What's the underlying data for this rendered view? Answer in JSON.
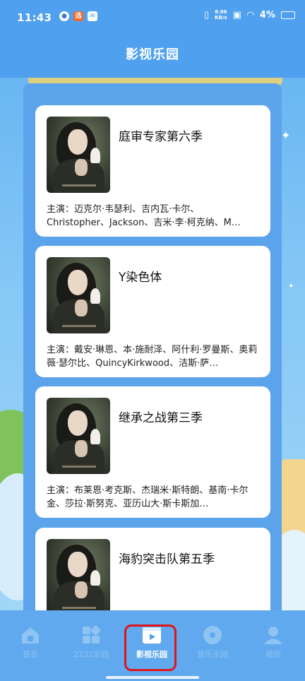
{
  "status_bar": {
    "time": "11:43",
    "net_speed": "8.90",
    "net_unit": "KB/s",
    "battery": "4%",
    "app_badge": "选"
  },
  "header": {
    "title": "影视乐园"
  },
  "movies": [
    {
      "title": "庭审专家第六季",
      "cast": "主演：迈克尔·韦瑟利、吉内瓦·卡尔、Christopher、Jackson、吉米·李·柯克纳、M…"
    },
    {
      "title": "Y染色体",
      "cast": "主演：戴安·琳恩、本·施耐泽、阿什利·罗曼斯、奥莉薇·瑟尔比、QuincyKirkwood、洁斯·萨…"
    },
    {
      "title": "继承之战第三季",
      "cast": "主演：布莱恩·考克斯、杰瑞米·斯特朗、基南·卡尔金、莎拉·斯努克、亚历山大·斯卡斯加…"
    },
    {
      "title": "海豹突击队第五季",
      "cast": ""
    }
  ],
  "tabs": [
    {
      "label": "首页"
    },
    {
      "label": "2232乐园"
    },
    {
      "label": "影视乐园"
    },
    {
      "label": "音乐乐园"
    },
    {
      "label": "我的"
    }
  ],
  "colors": {
    "accent": "#4fa0ee",
    "highlight": "#e0141c"
  }
}
